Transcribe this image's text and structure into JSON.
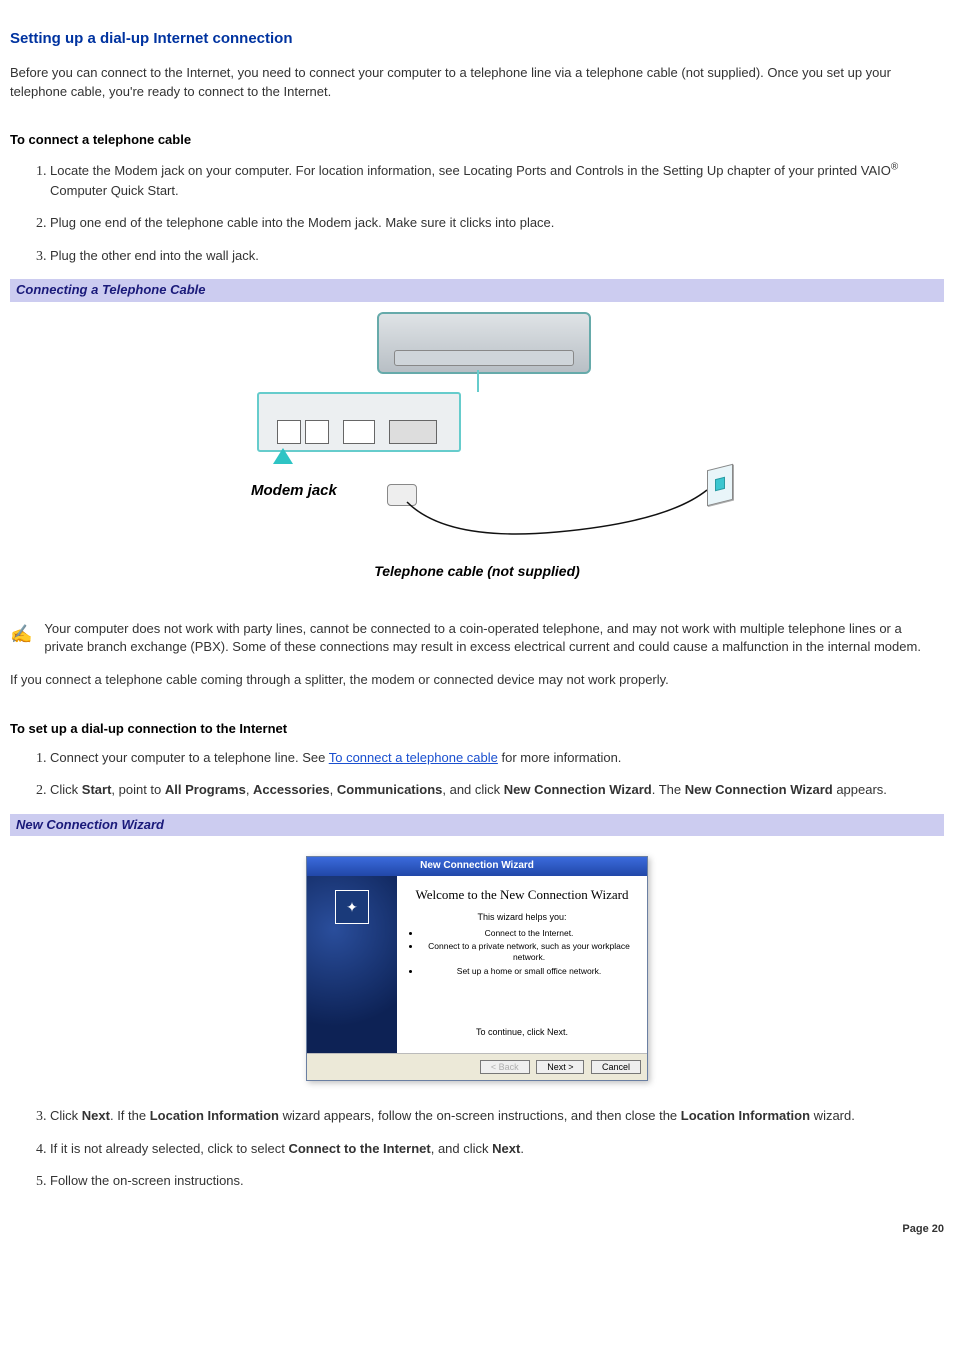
{
  "title": "Setting up a dial-up Internet connection",
  "intro": "Before you can connect to the Internet, you need to connect your computer to a telephone line via a telephone cable (not supplied). Once you set up your telephone cable, you're ready to connect to the Internet.",
  "section_a_heading": "To connect a telephone cable",
  "steps_a": {
    "s1a": "Locate the Modem jack on your computer. For location information, see Locating Ports and Controls in the Setting Up chapter of your printed VAIO",
    "s1b": " Computer Quick Start.",
    "s2": "Plug one end of the telephone cable into the Modem jack. Make sure it clicks into place.",
    "s3": "Plug the other end into the wall jack."
  },
  "figure1_caption": "Connecting a Telephone Cable",
  "diagram": {
    "label_modem": "Modem jack",
    "label_cable": "Telephone cable (not supplied)"
  },
  "note1_text": "Your computer does not work with party lines, cannot be connected to a coin-operated telephone, and may not work with multiple telephone lines or a private branch exchange (PBX). Some of these connections may result in excess electrical current and could cause a malfunction in the internal modem.",
  "note2_text": "If you connect a telephone cable coming through a splitter, the modem or connected device may not work properly.",
  "section_b_heading": "To set up a dial-up connection to the Internet",
  "steps_b": {
    "s1a": "Connect your computer to a telephone line. See ",
    "s1_link": "To connect a telephone cable",
    "s1b": " for more information.",
    "s2_parts": {
      "p1": "Click ",
      "b1": "Start",
      "p2": ", point to ",
      "b2": "All Programs",
      "p3": ", ",
      "b3": "Accessories",
      "p4": ", ",
      "b4": "Communications",
      "p5": ", and click ",
      "b5": "New Connection Wizard",
      "p6": ". The ",
      "b6": "New Connection Wizard",
      "p7": " appears."
    },
    "s3_parts": {
      "p1": "Click ",
      "b1": "Next",
      "p2": ". If the ",
      "b2": "Location Information",
      "p3": " wizard appears, follow the on-screen instructions, and then close the ",
      "b3": "Location Information",
      "p4": " wizard."
    },
    "s4_parts": {
      "p1": "If it is not already selected, click to select ",
      "b1": "Connect to the Internet",
      "p2": ", and click ",
      "b2": "Next",
      "p3": "."
    },
    "s5": "Follow the on-screen instructions."
  },
  "figure2_caption": "New Connection Wizard",
  "wizard": {
    "titlebar": "New Connection Wizard",
    "heading": "Welcome to the New Connection Wizard",
    "helps": "This wizard helps you:",
    "li1": "Connect to the Internet.",
    "li2": "Connect to a private network, such as your workplace network.",
    "li3": "Set up a home or small office network.",
    "continue": "To continue, click Next.",
    "btn_back": "< Back",
    "btn_next": "Next >",
    "btn_cancel": "Cancel"
  },
  "page_number": "Page 20",
  "reg_symbol": "®"
}
